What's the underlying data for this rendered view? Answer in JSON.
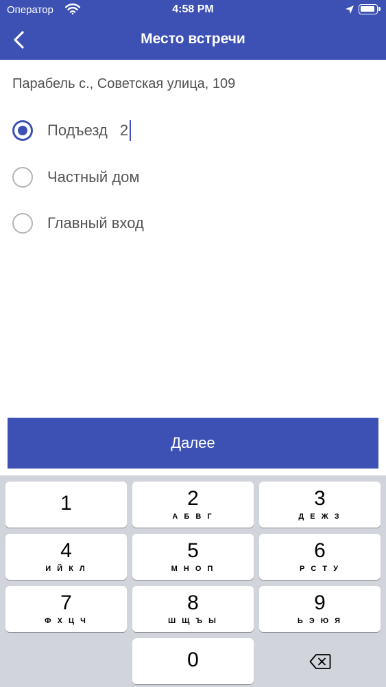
{
  "status_bar": {
    "carrier": "Оператор",
    "time": "4:58 PM"
  },
  "nav": {
    "title": "Место встречи",
    "back_icon": "chevron-left-icon"
  },
  "address": "Парабель с., Советская улица, 109",
  "options": [
    {
      "label": "Подъезд",
      "value": "2",
      "selected": true
    },
    {
      "label": "Частный дом",
      "selected": false
    },
    {
      "label": "Главный вход",
      "selected": false
    }
  ],
  "next_button": {
    "label": "Далее"
  },
  "keyboard": {
    "keys": [
      {
        "num": "1",
        "letters": ""
      },
      {
        "num": "2",
        "letters": "А Б В Г"
      },
      {
        "num": "3",
        "letters": "Д Е Ж З"
      },
      {
        "num": "4",
        "letters": "И Й К Л"
      },
      {
        "num": "5",
        "letters": "М Н О П"
      },
      {
        "num": "6",
        "letters": "Р С Т У"
      },
      {
        "num": "7",
        "letters": "Ф Х Ц Ч"
      },
      {
        "num": "8",
        "letters": "Ш Щ Ъ Ы"
      },
      {
        "num": "9",
        "letters": "Ь Э Ю Я"
      },
      {
        "num": "0",
        "letters": ""
      }
    ],
    "delete_icon": "backspace-icon"
  },
  "colors": {
    "accent": "#3d51b4",
    "keyboard_bg": "#d1d4da"
  }
}
